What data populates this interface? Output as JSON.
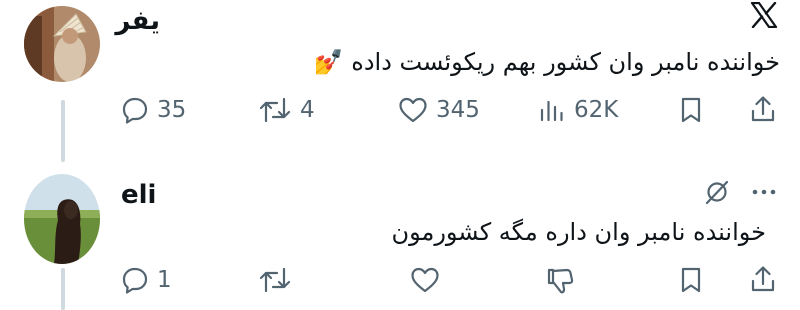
{
  "tweet1": {
    "display_name": "یفر",
    "text": "خواننده نامبر وان کشور بهم ریکوئست داده",
    "emoji": "💅",
    "actions": {
      "replies": "35",
      "reposts": "4",
      "likes": "345",
      "views": "62K"
    }
  },
  "tweet2": {
    "display_name": "eli",
    "text": "خواننده نامبر وان داره مگه کشورمون",
    "actions": {
      "replies": "1"
    }
  },
  "icons": {
    "logo": "x-logo-icon",
    "grok": "grok-icon",
    "more": "more-icon",
    "reply": "reply-icon",
    "repost": "repost-icon",
    "like": "heart-icon",
    "views": "views-icon",
    "dislike": "dislike-icon",
    "bookmark": "bookmark-icon",
    "share": "share-icon"
  },
  "colors": {
    "icon": "#536471",
    "text": "#0f1419",
    "thread_line": "#cfd9de"
  }
}
